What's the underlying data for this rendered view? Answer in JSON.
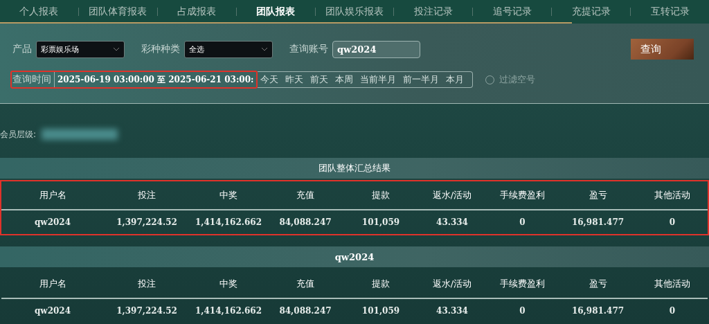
{
  "tabs": [
    {
      "label": "个人报表",
      "selected": false
    },
    {
      "label": "团队体育报表",
      "selected": false
    },
    {
      "label": "占成报表",
      "selected": false
    },
    {
      "label": "团队报表",
      "selected": true
    },
    {
      "label": "团队娱乐报表",
      "selected": false
    },
    {
      "label": "投注记录",
      "selected": false
    },
    {
      "label": "追号记录",
      "selected": false
    },
    {
      "label": "充提记录",
      "selected": false
    },
    {
      "label": "互转记录",
      "selected": false
    }
  ],
  "filters": {
    "product": {
      "label": "产品",
      "value": "彩票娱乐场"
    },
    "lottery_type": {
      "label": "彩种种类",
      "value": "全选"
    },
    "account": {
      "label": "查询账号",
      "value": "qw2024"
    },
    "query_button": "查询",
    "time": {
      "label": "查询时间",
      "value": "2025-06-19 03:00:00 至 2025-06-21 03:00:",
      "highlighted": true
    },
    "quick_ranges": [
      "今天",
      "昨天",
      "前天",
      "本周",
      "当前半月",
      "前一半月",
      "本月"
    ],
    "filter_empty": {
      "label": "过滤空号",
      "checked": false
    }
  },
  "member_level": {
    "label": "会员层级:"
  },
  "tables": [
    {
      "title": "团队整体汇总结果",
      "highlighted": true,
      "columns": [
        "用户名",
        "投注",
        "中奖",
        "充值",
        "提款",
        "返水/活动",
        "手续费盈利",
        "盈亏",
        "其他活动"
      ],
      "rows": [
        [
          "qw2024",
          "1,397,224.52",
          "1,414,162.662",
          "84,088.247",
          "101,059",
          "43.334",
          "0",
          "16,981.477",
          "0"
        ]
      ]
    },
    {
      "title": "qw2024",
      "highlighted": false,
      "columns": [
        "用户名",
        "投注",
        "中奖",
        "充值",
        "提款",
        "返水/活动",
        "手续费盈利",
        "盈亏",
        "其他活动"
      ],
      "rows": [
        [
          "qw2024",
          "1,397,224.52",
          "1,414,162.662",
          "84,088.247",
          "101,059",
          "43.334",
          "0",
          "16,981.477",
          "0"
        ]
      ]
    }
  ]
}
